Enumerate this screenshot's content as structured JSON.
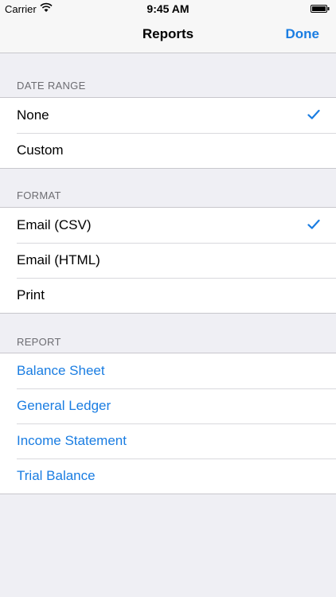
{
  "status": {
    "carrier": "Carrier",
    "time": "9:45 AM"
  },
  "nav": {
    "title": "Reports",
    "done_label": "Done"
  },
  "sections": {
    "date_range": {
      "header": "DATE RANGE",
      "items": [
        {
          "label": "None",
          "selected": true
        },
        {
          "label": "Custom",
          "selected": false
        }
      ]
    },
    "format": {
      "header": "FORMAT",
      "items": [
        {
          "label": "Email (CSV)",
          "selected": true
        },
        {
          "label": "Email (HTML)",
          "selected": false
        },
        {
          "label": "Print",
          "selected": false
        }
      ]
    },
    "report": {
      "header": "REPORT",
      "items": [
        {
          "label": "Balance Sheet"
        },
        {
          "label": "General Ledger"
        },
        {
          "label": "Income Statement"
        },
        {
          "label": "Trial Balance"
        }
      ]
    }
  },
  "colors": {
    "accent": "#1a7de2",
    "background": "#efeff4",
    "header_text": "#6d6d72"
  }
}
